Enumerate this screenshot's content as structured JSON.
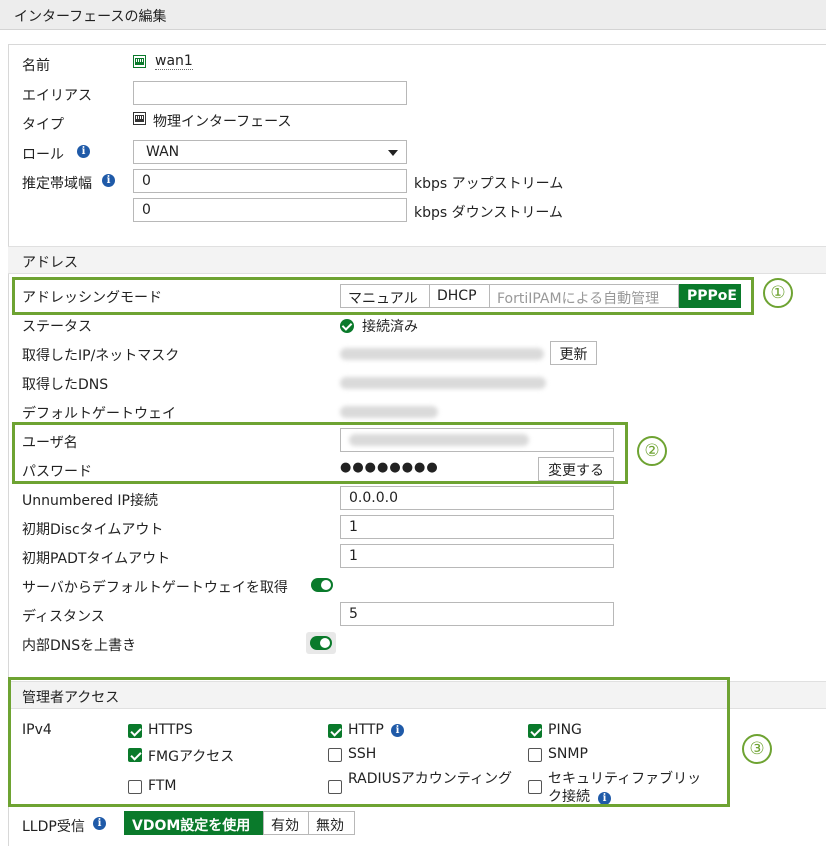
{
  "header": {
    "title": "インターフェースの編集"
  },
  "interface": {
    "name_label": "名前",
    "name_value": "wan1",
    "alias_label": "エイリアス",
    "alias_value": "",
    "type_label": "タイプ",
    "type_value": "物理インターフェース",
    "role_label": "ロール",
    "role_value": "WAN",
    "bandwidth_label": "推定帯域幅",
    "upstream_value": "0",
    "upstream_unit": "kbps アップストリーム",
    "downstream_value": "0",
    "downstream_unit": "kbps ダウンストリーム"
  },
  "address": {
    "section_title": "アドレス",
    "mode_label": "アドレッシングモード",
    "mode_options": [
      "マニュアル",
      "DHCP",
      "FortiIPAMによる自動管理",
      "PPPoE"
    ],
    "mode_selected": "PPPoE",
    "status_label": "ステータス",
    "status_value": "接続済み",
    "ip_label": "取得したIP/ネットマスク",
    "refresh_button": "更新",
    "dns_label": "取得したDNS",
    "gateway_label": "デフォルトゲートウェイ",
    "username_label": "ユーザ名",
    "password_label": "パスワード",
    "password_value": "●●●●●●●●",
    "change_button": "変更する",
    "unnumbered_label": "Unnumbered IP接続",
    "unnumbered_value": "0.0.0.0",
    "disc_label": "初期Discタイムアウト",
    "disc_value": "1",
    "padt_label": "初期PADTタイムアウト",
    "padt_value": "1",
    "default_gw_label": "サーバからデフォルトゲートウェイを取得",
    "default_gw_enabled": true,
    "distance_label": "ディスタンス",
    "distance_value": "5",
    "dns_override_label": "内部DNSを上書き",
    "dns_override_enabled": true
  },
  "admin_access": {
    "section_title": "管理者アクセス",
    "ipv4_label": "IPv4",
    "options": [
      {
        "label": "HTTPS",
        "checked": true
      },
      {
        "label": "HTTP",
        "checked": true
      },
      {
        "label": "PING",
        "checked": true
      },
      {
        "label": "FMGアクセス",
        "checked": true
      },
      {
        "label": "SSH",
        "checked": false
      },
      {
        "label": "SNMP",
        "checked": false
      },
      {
        "label": "FTM",
        "checked": false
      },
      {
        "label": "RADIUSアカウンティング",
        "checked": false
      },
      {
        "label": "セキュリティファブリック接続",
        "checked": false
      }
    ]
  },
  "lldp": {
    "label": "LLDP受信",
    "options": [
      "VDOM設定を使用",
      "有効",
      "無効"
    ],
    "selected": "VDOM設定を使用"
  },
  "annotations": [
    "①",
    "②",
    "③"
  ],
  "colors": {
    "accent_green": "#0a7a2b",
    "annotation_green": "#6ea332",
    "info_blue": "#1f5aa8"
  }
}
